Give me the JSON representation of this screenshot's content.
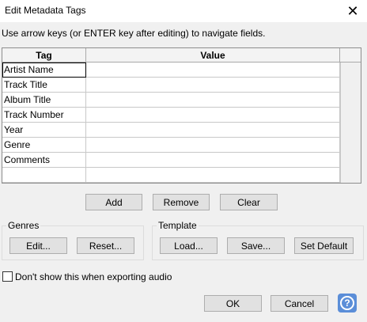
{
  "window": {
    "title": "Edit Metadata Tags",
    "close_glyph": "✕"
  },
  "instructions": "Use arrow keys (or ENTER key after editing) to navigate fields.",
  "grid": {
    "columns": [
      "Tag",
      "Value"
    ],
    "rows": [
      {
        "tag": "Artist Name",
        "value": ""
      },
      {
        "tag": "Track Title",
        "value": ""
      },
      {
        "tag": "Album Title",
        "value": ""
      },
      {
        "tag": "Track Number",
        "value": ""
      },
      {
        "tag": "Year",
        "value": ""
      },
      {
        "tag": "Genre",
        "value": ""
      },
      {
        "tag": "Comments",
        "value": ""
      },
      {
        "tag": "",
        "value": ""
      }
    ]
  },
  "row_buttons": {
    "add": "Add",
    "remove": "Remove",
    "clear": "Clear"
  },
  "genres": {
    "label": "Genres",
    "edit": "Edit...",
    "reset": "Reset..."
  },
  "template": {
    "label": "Template",
    "load": "Load...",
    "save": "Save...",
    "set_default": "Set Default"
  },
  "dont_show": {
    "label": "Don't show this when exporting audio",
    "checked": false
  },
  "footer": {
    "ok": "OK",
    "cancel": "Cancel",
    "help_glyph": "?"
  }
}
